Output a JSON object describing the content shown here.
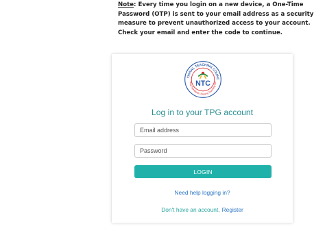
{
  "note": {
    "label": "Note",
    "text": ": Every time you login on a new device, a One-Time Password (OTP) is sent to your email address as a security measure to prevent unauthorized access to your account. Check your email and enter the code to continue."
  },
  "logo": {
    "top_text": "NATIONAL TEACHING COUNCIL",
    "letters": "NTC",
    "bottom_text": "Building Standards, Raising Teaching Quality",
    "icon": "ntc-logo"
  },
  "login_form": {
    "title": "Log in to your TPG account",
    "email_placeholder": "Email address",
    "password_placeholder": "Password",
    "login_label": "LOGIN",
    "help_link": "Need help logging in?",
    "no_account_text": "Don't have an account,",
    "register_link": "Register"
  },
  "colors": {
    "accent": "#20b2aa",
    "title": "#2a8f93",
    "link": "#2f78c4",
    "logo_red": "#d9252a",
    "logo_blue": "#2b5aa8"
  }
}
